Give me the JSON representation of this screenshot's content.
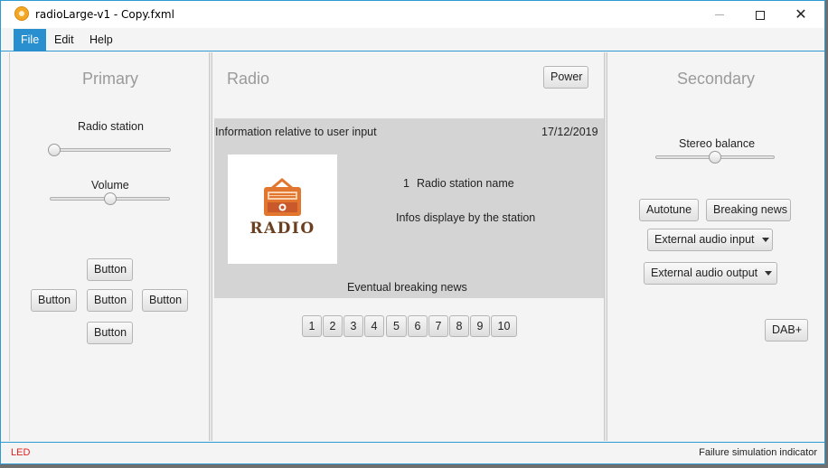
{
  "window": {
    "title": "radioLarge-v1 - Copy.fxml",
    "minimize_symbol": "—",
    "close_symbol": "✕"
  },
  "menu": {
    "items": [
      "File",
      "Edit",
      "Help"
    ],
    "active": "File"
  },
  "primary": {
    "title": "Primary",
    "radio_station_label": "Radio station",
    "radio_station_level": 0.0,
    "volume_label": "Volume",
    "volume_level": 0.5,
    "buttons": [
      "Button",
      "Button",
      "Button",
      "Button",
      "Button"
    ]
  },
  "radio": {
    "title": "Radio",
    "power_label": "Power",
    "info_text": "Information relative to user input",
    "date": "17/12/2019",
    "logo_text": "RADIO",
    "station_number": "1",
    "station_name": "Radio station name",
    "station_infos": "Infos displaye by the station",
    "breaking_news": "Eventual breaking news",
    "pages": [
      "1",
      "2",
      "3",
      "4",
      "5",
      "6",
      "7",
      "8",
      "9",
      "10"
    ]
  },
  "secondary": {
    "title": "Secondary",
    "stereo_balance_label": "Stereo balance",
    "stereo_balance_level": 0.5,
    "autotune_label": "Autotune",
    "breaking_news_label": "Breaking news",
    "external_audio_input_label": "External audio input",
    "external_audio_output_label": "External audio output",
    "dab_label": "DAB+"
  },
  "status": {
    "led_text": "LED",
    "failure_text": "Failure simulation indicator"
  },
  "colors": {
    "accent": "#2a8fce",
    "led": "#e02020",
    "logo_orange": "#e3762e",
    "logo_text": "#6b3f1f"
  }
}
